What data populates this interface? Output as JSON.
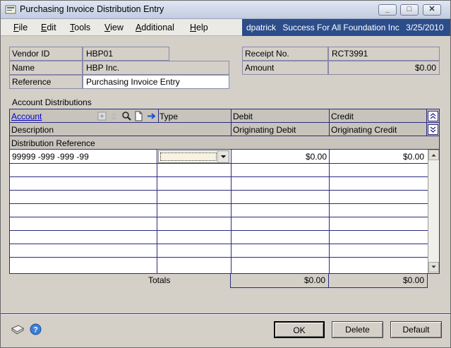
{
  "window": {
    "title": "Purchasing Invoice Distribution Entry",
    "controls": [
      "minimize",
      "maximize",
      "close"
    ]
  },
  "menu": [
    "File",
    "Edit",
    "Tools",
    "View",
    "Additional",
    "Help"
  ],
  "userbar": {
    "user": "dpatrick",
    "company": "Success For All Foundation Inc",
    "date": "3/25/2010"
  },
  "header_fields": {
    "vendor_id": {
      "label": "Vendor ID",
      "value": "HBP01"
    },
    "name": {
      "label": "Name",
      "value": "HBP Inc."
    },
    "reference": {
      "label": "Reference",
      "value": "Purchasing Invoice Entry"
    },
    "receipt_no": {
      "label": "Receipt No.",
      "value": "RCT3991"
    },
    "amount": {
      "label": "Amount",
      "value": "$0.00"
    }
  },
  "distributions": {
    "section_label": "Account Distributions",
    "columns": {
      "account": "Account",
      "type": "Type",
      "debit": "Debit",
      "credit": "Credit",
      "description": "Description",
      "originating_debit": "Originating Debit",
      "originating_credit": "Originating Credit",
      "distribution_reference": "Distribution Reference"
    },
    "rows": [
      {
        "account": "99999 -999 -999 -99",
        "type": "",
        "debit": "$0.00",
        "credit": "$0.00"
      }
    ],
    "totals_label": "Totals",
    "totals": {
      "debit": "$0.00",
      "credit": "$0.00"
    }
  },
  "buttons": {
    "ok": "OK",
    "delete": "Delete",
    "default": "Default"
  },
  "icons": [
    "app-icon",
    "expand-icon",
    "lookup-icon",
    "note-icon",
    "goto-arrow-icon",
    "collapse-icon",
    "scroll-up-icon",
    "scroll-down-icon",
    "notes-icon",
    "help-icon"
  ]
}
